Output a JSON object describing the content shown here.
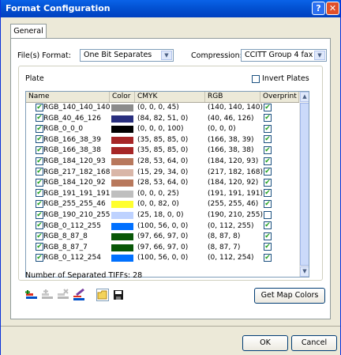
{
  "window": {
    "title": "Format Configuration"
  },
  "tabs": [
    "General"
  ],
  "format": {
    "label": "File(s) Format:",
    "value": "One Bit Separates"
  },
  "compression": {
    "label": "Compression:",
    "value": "CCITT Group 4 fax"
  },
  "plate": {
    "label": "Plate",
    "invert_label": "Invert Plates",
    "invert_checked": false
  },
  "grid": {
    "columns": [
      "Name",
      "Color",
      "CMYK",
      "RGB",
      "Overprint"
    ],
    "rows": [
      {
        "name": "RGB_140_140_140",
        "color": "#8c8c8c",
        "cmyk": "(0, 0, 0, 45)",
        "rgb": "(140, 140, 140)",
        "overprint": true
      },
      {
        "name": "RGB_40_46_126",
        "color": "#282e7e",
        "cmyk": "(84, 82, 51, 0)",
        "rgb": "(40, 46, 126)",
        "overprint": true
      },
      {
        "name": "RGB_0_0_0",
        "color": "#000000",
        "cmyk": "(0, 0, 0, 100)",
        "rgb": "(0, 0, 0)",
        "overprint": true
      },
      {
        "name": "RGB_166_38_39",
        "color": "#a62627",
        "cmyk": "(35, 85, 85, 0)",
        "rgb": "(166, 38, 39)",
        "overprint": true
      },
      {
        "name": "RGB_166_38_38",
        "color": "#a62626",
        "cmyk": "(35, 85, 85, 0)",
        "rgb": "(166, 38, 38)",
        "overprint": true
      },
      {
        "name": "RGB_184_120_93",
        "color": "#b8785d",
        "cmyk": "(28, 53, 64, 0)",
        "rgb": "(184, 120, 93)",
        "overprint": true
      },
      {
        "name": "RGB_217_182_168",
        "color": "#d9b6a8",
        "cmyk": "(15, 29, 34, 0)",
        "rgb": "(217, 182, 168)",
        "overprint": true
      },
      {
        "name": "RGB_184_120_92",
        "color": "#b8785c",
        "cmyk": "(28, 53, 64, 0)",
        "rgb": "(184, 120, 92)",
        "overprint": true
      },
      {
        "name": "RGB_191_191_191",
        "color": "#bfbfbf",
        "cmyk": "(0, 0, 0, 25)",
        "rgb": "(191, 191, 191)",
        "overprint": true
      },
      {
        "name": "RGB_255_255_46",
        "color": "#ffff2e",
        "cmyk": "(0, 0, 82, 0)",
        "rgb": "(255, 255, 46)",
        "overprint": true
      },
      {
        "name": "RGB_190_210_255",
        "color": "#bed2ff",
        "cmyk": "(25, 18, 0, 0)",
        "rgb": "(190, 210, 255)",
        "overprint": false
      },
      {
        "name": "RGB_0_112_255",
        "color": "#0070ff",
        "cmyk": "(100, 56, 0, 0)",
        "rgb": "(0, 112, 255)",
        "overprint": true
      },
      {
        "name": "RGB_8_87_8",
        "color": "#085708",
        "cmyk": "(97, 66, 97, 0)",
        "rgb": "(8, 87, 8)",
        "overprint": true
      },
      {
        "name": "RGB_8_87_7",
        "color": "#085707",
        "cmyk": "(97, 66, 97, 0)",
        "rgb": "(8, 87, 7)",
        "overprint": true
      },
      {
        "name": "RGB_0_112_254",
        "color": "#0070fe",
        "cmyk": "(100, 56, 0, 0)",
        "rgb": "(0, 112, 254)",
        "overprint": true
      }
    ]
  },
  "status": {
    "text": "Number of Separated TIFFs: 28"
  },
  "toolbar": {
    "icons": [
      "add-plate-icon",
      "add-plate-disabled-icon",
      "delete-plate-icon",
      "edit-color-icon",
      "open-folder-icon",
      "save-icon"
    ]
  },
  "buttons": {
    "get_map_colors": "Get Map Colors",
    "ok": "OK",
    "cancel": "Cancel"
  }
}
